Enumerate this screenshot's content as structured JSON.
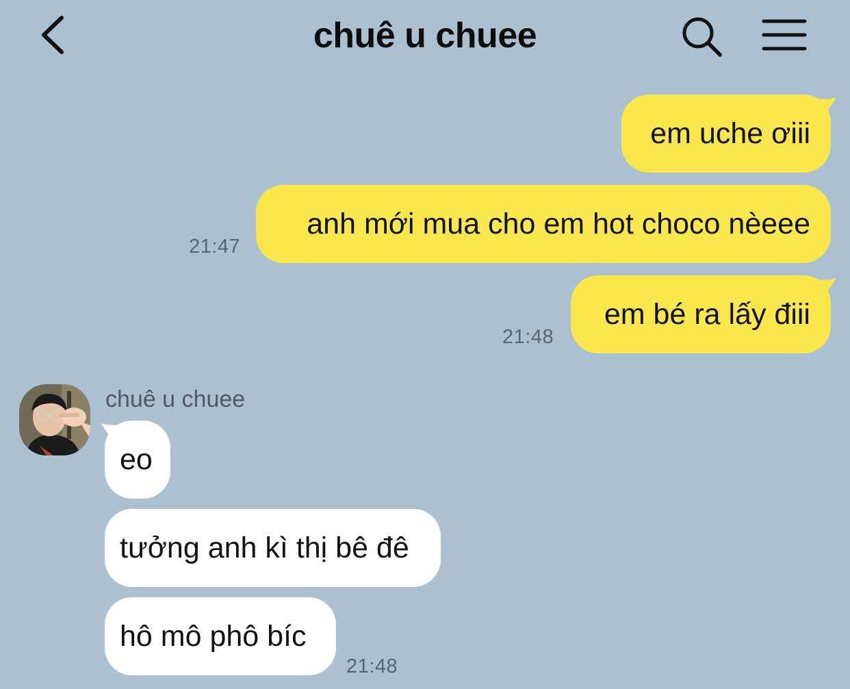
{
  "header": {
    "title": "chuê u chuee",
    "back_icon": "chevron-left-icon",
    "search_icon": "search-icon",
    "menu_icon": "hamburger-menu-icon"
  },
  "colors": {
    "background": "#abc1d1",
    "my_bubble": "#fae64d",
    "their_bubble": "#ffffff"
  },
  "messages": {
    "sent": [
      {
        "text": "em uche ơiii"
      },
      {
        "text": "anh mới mua cho em hot choco nèeee",
        "time": "21:47"
      },
      {
        "text": "em bé ra lấy điii",
        "time": "21:48"
      }
    ],
    "received_group": {
      "sender": "chuê u chuee",
      "items": [
        {
          "text": "eo"
        },
        {
          "text": "tưởng anh kì thị bê đê"
        },
        {
          "text": "hô mô phô bíc",
          "time": "21:48"
        }
      ]
    }
  }
}
